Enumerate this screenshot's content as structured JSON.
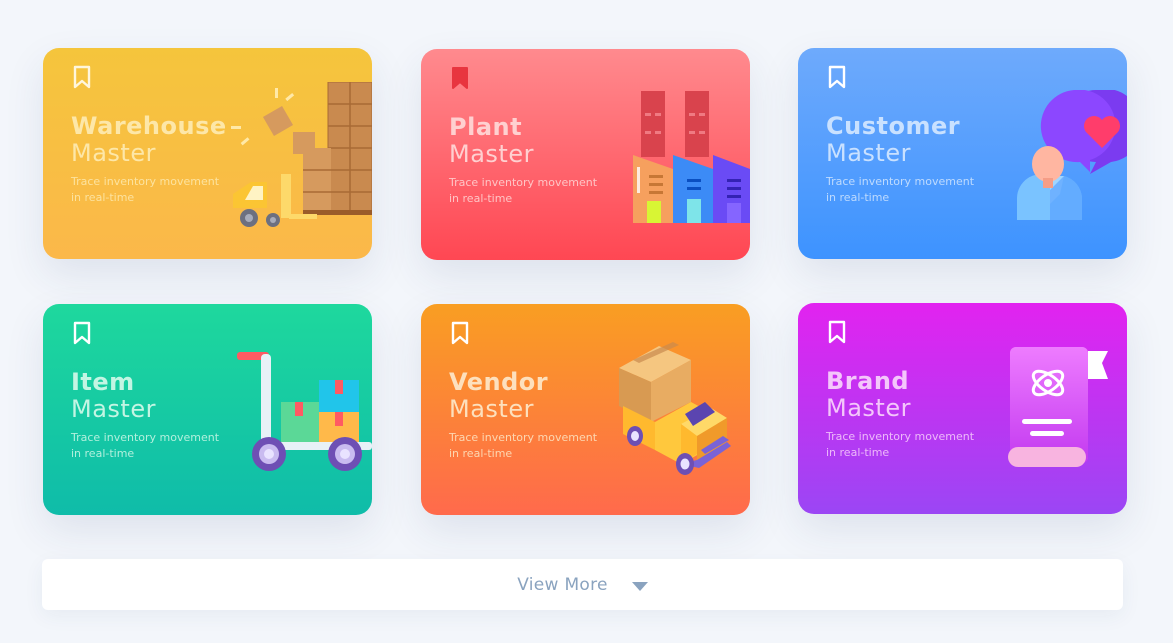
{
  "cards": [
    {
      "title": "Warehouse",
      "subtitle": "Master",
      "description": "Trace inventory movement in real-time",
      "bookmark_color": "#fff6dc",
      "illustration": "warehouse-boxes-forklift"
    },
    {
      "title": "Plant",
      "subtitle": "Master",
      "description": "Trace inventory movement in real-time",
      "bookmark_color": "#e8353f",
      "illustration": "factory"
    },
    {
      "title": "Customer",
      "subtitle": "Master",
      "description": "Trace inventory movement in real-time",
      "bookmark_color": "#ffffff",
      "illustration": "customer-heart-bubble"
    },
    {
      "title": "Item",
      "subtitle": "Master",
      "description": "Trace inventory movement in real-time",
      "bookmark_color": "#ffffff",
      "illustration": "hand-truck-boxes"
    },
    {
      "title": "Vendor",
      "subtitle": "Master",
      "description": "Trace inventory movement in real-time",
      "bookmark_color": "#ffffff",
      "illustration": "delivery-truck"
    },
    {
      "title": "Brand",
      "subtitle": "Master",
      "description": "Trace inventory movement in real-time",
      "bookmark_color": "#ffffff",
      "illustration": "brand-book"
    }
  ],
  "view_more": {
    "label": "View More",
    "icon": "caret-down-icon"
  },
  "colors": {
    "background": "#f3f6fb",
    "view_more_text": "#8aa3bf"
  }
}
